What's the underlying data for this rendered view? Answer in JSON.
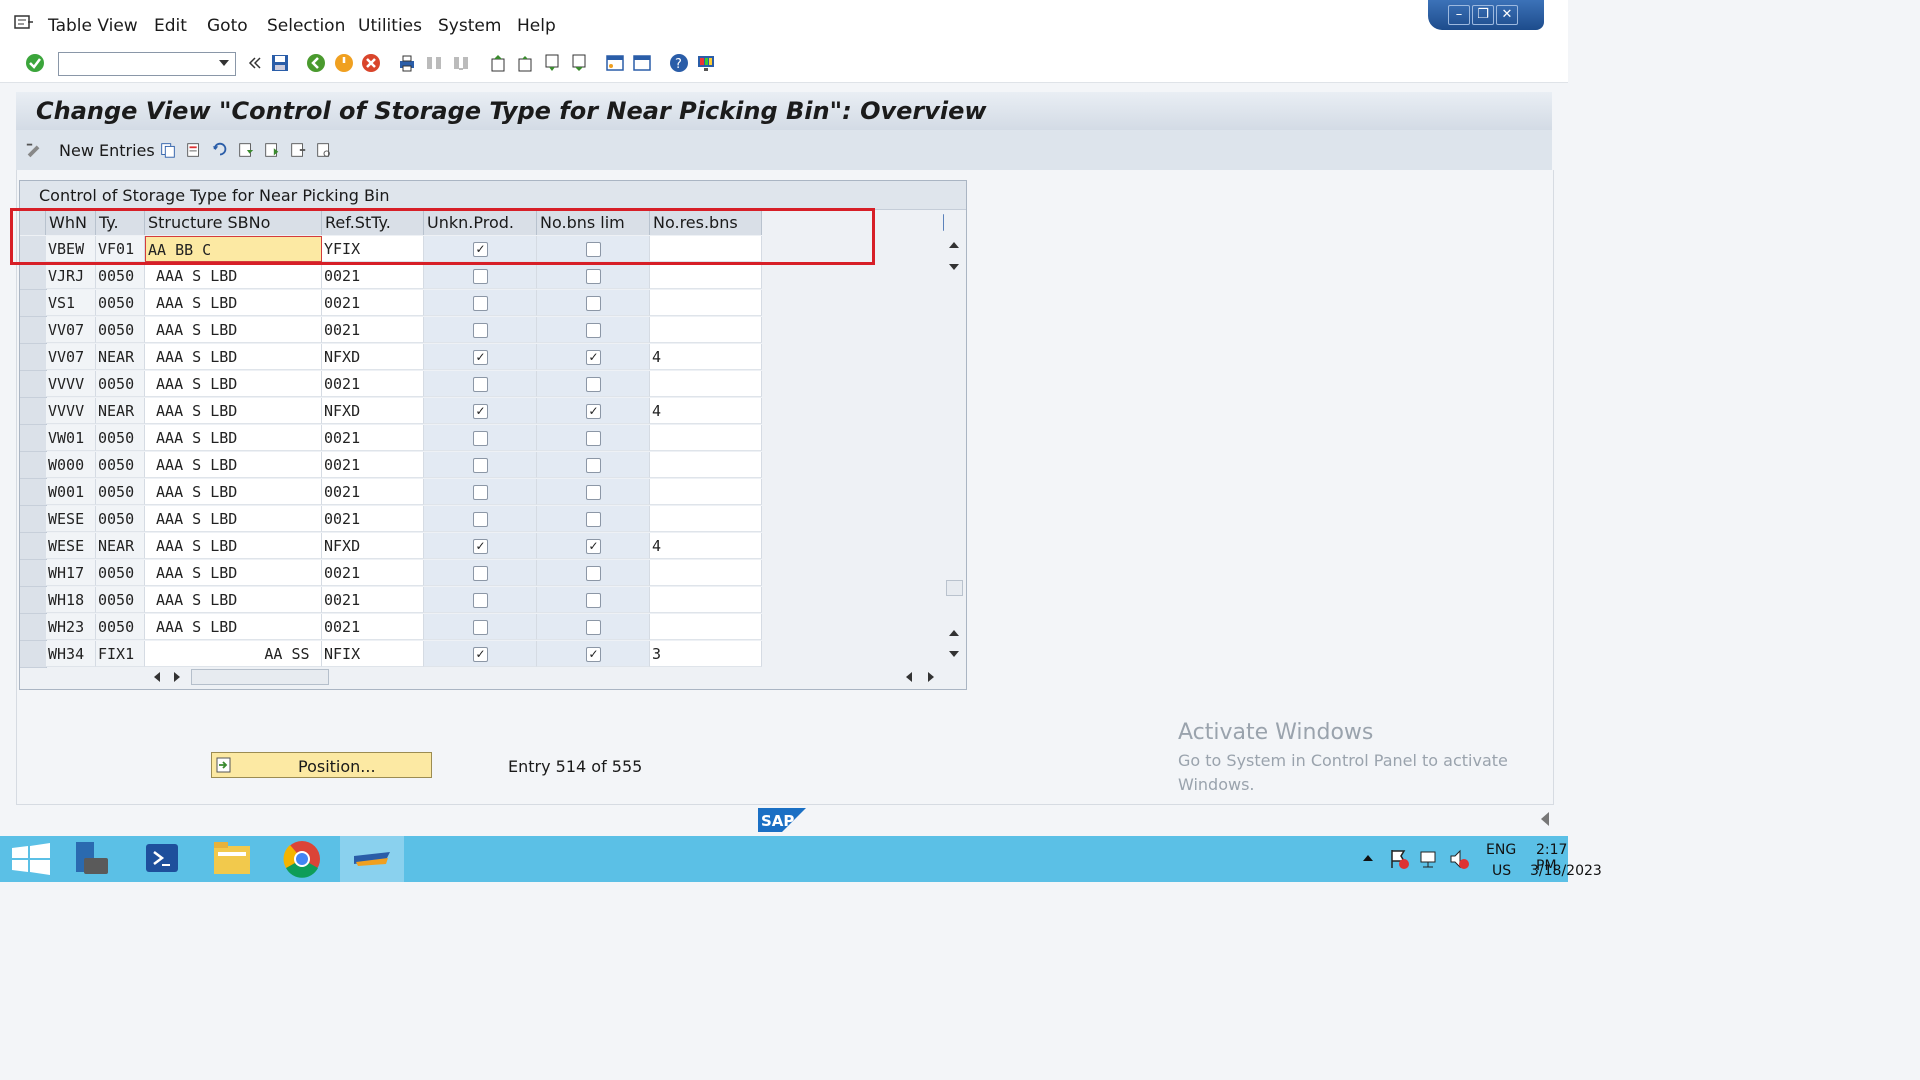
{
  "menu": [
    "Table View",
    "Edit",
    "Goto",
    "Selection",
    "Utilities",
    "System",
    "Help"
  ],
  "title": "Change View \"Control of Storage Type for Near Picking Bin\": Overview",
  "app_toolbar": {
    "new_entries": "New Entries"
  },
  "table": {
    "caption": "Control of Storage Type for Near Picking Bin",
    "headers": [
      "WhN",
      "Ty.",
      "Structure SBNo",
      "Ref.StTy.",
      "Unkn.Prod.",
      "No.bns lim",
      "No.res.bns"
    ],
    "rows": [
      {
        "whn": "VBEW",
        "ty": "VF01",
        "sbno": "AA BB C",
        "ref": "YFIX",
        "unkn": true,
        "lim": false,
        "res": ""
      },
      {
        "whn": "VJRJ",
        "ty": "0050",
        "sbno": " AAA S LBD",
        "ref": "0021",
        "unkn": false,
        "lim": false,
        "res": ""
      },
      {
        "whn": "VS1",
        "ty": "0050",
        "sbno": " AAA S LBD",
        "ref": "0021",
        "unkn": false,
        "lim": false,
        "res": ""
      },
      {
        "whn": "VV07",
        "ty": "0050",
        "sbno": " AAA S LBD",
        "ref": "0021",
        "unkn": false,
        "lim": false,
        "res": ""
      },
      {
        "whn": "VV07",
        "ty": "NEAR",
        "sbno": " AAA S LBD",
        "ref": "NFXD",
        "unkn": true,
        "lim": true,
        "res": "4"
      },
      {
        "whn": "VVVV",
        "ty": "0050",
        "sbno": " AAA S LBD",
        "ref": "0021",
        "unkn": false,
        "lim": false,
        "res": ""
      },
      {
        "whn": "VVVV",
        "ty": "NEAR",
        "sbno": " AAA S LBD",
        "ref": "NFXD",
        "unkn": true,
        "lim": true,
        "res": "4"
      },
      {
        "whn": "VW01",
        "ty": "0050",
        "sbno": " AAA S LBD",
        "ref": "0021",
        "unkn": false,
        "lim": false,
        "res": ""
      },
      {
        "whn": "W000",
        "ty": "0050",
        "sbno": " AAA S LBD",
        "ref": "0021",
        "unkn": false,
        "lim": false,
        "res": ""
      },
      {
        "whn": "W001",
        "ty": "0050",
        "sbno": " AAA S LBD",
        "ref": "0021",
        "unkn": false,
        "lim": false,
        "res": ""
      },
      {
        "whn": "WESE",
        "ty": "0050",
        "sbno": " AAA S LBD",
        "ref": "0021",
        "unkn": false,
        "lim": false,
        "res": ""
      },
      {
        "whn": "WESE",
        "ty": "NEAR",
        "sbno": " AAA S LBD",
        "ref": "NFXD",
        "unkn": true,
        "lim": true,
        "res": "4"
      },
      {
        "whn": "WH17",
        "ty": "0050",
        "sbno": " AAA S LBD",
        "ref": "0021",
        "unkn": false,
        "lim": false,
        "res": ""
      },
      {
        "whn": "WH18",
        "ty": "0050",
        "sbno": " AAA S LBD",
        "ref": "0021",
        "unkn": false,
        "lim": false,
        "res": ""
      },
      {
        "whn": "WH23",
        "ty": "0050",
        "sbno": " AAA S LBD",
        "ref": "0021",
        "unkn": false,
        "lim": false,
        "res": ""
      },
      {
        "whn": "WH34",
        "ty": "FIX1",
        "sbno": "             AA SS ",
        "ref": "NFIX",
        "unkn": true,
        "lim": true,
        "res": "3"
      }
    ]
  },
  "position_button": "Position...",
  "entry_info": "Entry 514 of 555",
  "watermark": {
    "title": "Activate Windows",
    "text": "Go to System in Control Panel to activate Windows."
  },
  "sap_logo": "SAP",
  "taskbar": {
    "lang1": "ENG",
    "lang2": "US",
    "time": "2:17 PM",
    "date": "3/18/2023"
  },
  "colors": {
    "focus_cell": "#fce9a3",
    "highlight_box": "#d71f27",
    "title_bg": "#d3dbe5",
    "taskbar": "#5bc0e6"
  }
}
